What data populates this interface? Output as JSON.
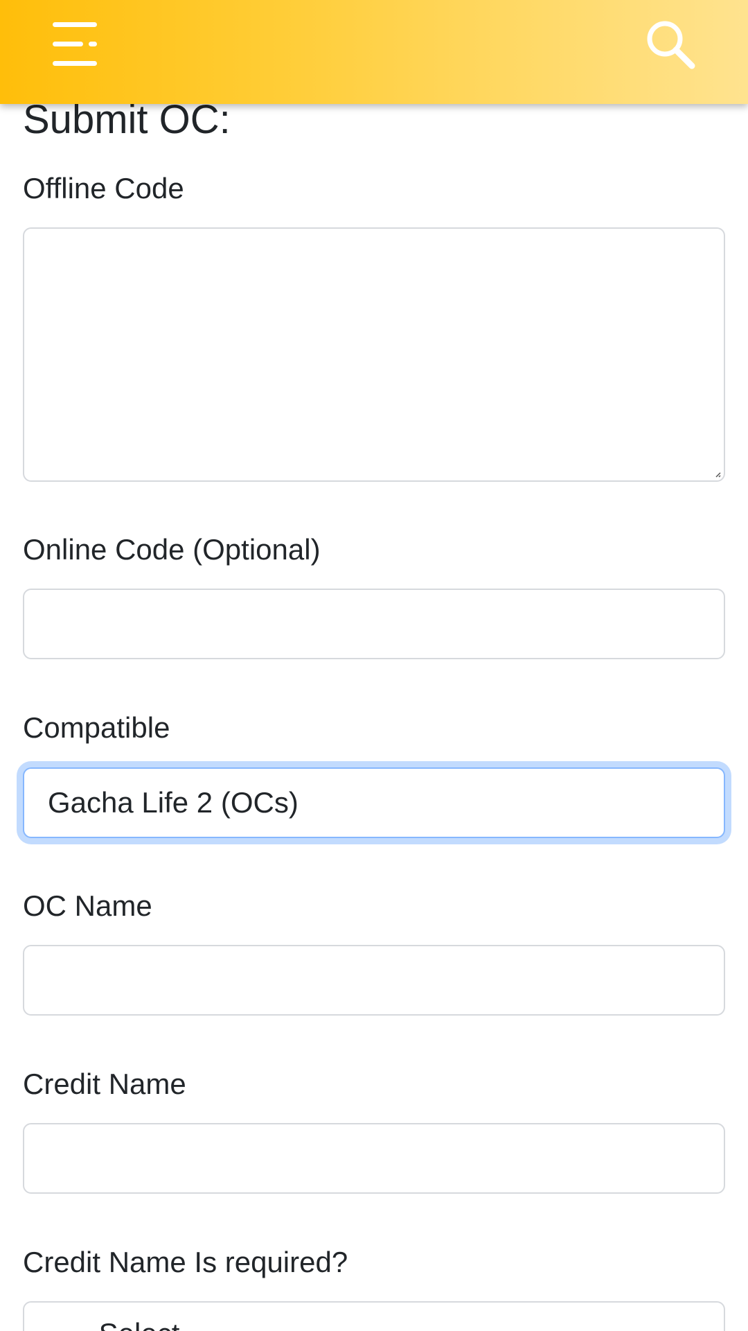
{
  "header": {
    "menu_icon": "menu-icon",
    "search_icon": "search-icon",
    "gradient_colors": [
      "#ffbe0a",
      "#ffe38f"
    ]
  },
  "form": {
    "title": "Submit OC:",
    "offline_code": {
      "label": "Offline Code",
      "value": ""
    },
    "online_code": {
      "label": "Online Code (Optional)",
      "value": ""
    },
    "compatible": {
      "label": "Compatible",
      "selected": "Gacha Life 2 (OCs)"
    },
    "oc_name": {
      "label": "OC Name",
      "value": ""
    },
    "credit_name": {
      "label": "Credit Name",
      "value": ""
    },
    "credit_required": {
      "label": "Credit Name Is required?",
      "selected": "-- Select --"
    }
  },
  "colors": {
    "focus_border": "#86b7fe",
    "input_border": "#d6d9dd",
    "text": "#212529"
  }
}
